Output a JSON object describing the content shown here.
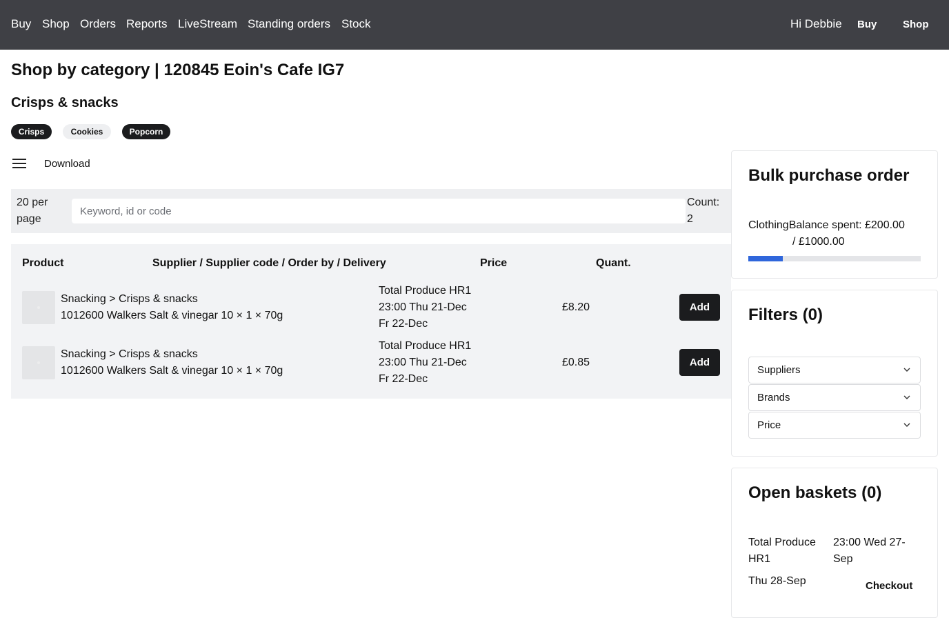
{
  "nav": {
    "links": [
      "Buy",
      "Shop",
      "Orders",
      "Reports",
      "LiveStream",
      "Standing orders",
      "Stock"
    ],
    "greeting": "Hi Debbie",
    "right_buttons": [
      "Buy",
      "Shop"
    ]
  },
  "page": {
    "title": "Shop by category | 120845 Eoin's Cafe IG7",
    "section": "Crisps & snacks",
    "subcategories": [
      "Crisps",
      "Cookies",
      "Popcorn"
    ],
    "download_label": "Download"
  },
  "toolbar": {
    "per_page": "20 per page",
    "search_placeholder": "Keyword, id or code",
    "count_label": "Count:",
    "count_value": "2"
  },
  "table": {
    "headers": [
      "Product",
      "Supplier / Supplier code / Order by / Delivery",
      "Price",
      "Quant."
    ],
    "rows": [
      {
        "category": "Snacking > Crisps & snacks",
        "product": "1012600 Walkers Salt & vinegar 10 × 1 × 70g",
        "supplier": "Total Produce HR1",
        "order_by": "23:00 Thu 21-Dec",
        "delivery": "Fr 22-Dec",
        "price": "£8.20",
        "action": "Add"
      },
      {
        "category": "Snacking > Crisps & snacks",
        "product": "1012600 Walkers Salt & vinegar 10 × 1 × 70g",
        "supplier": "Total Produce HR1",
        "order_by": "23:00 Thu 21-Dec",
        "delivery": "Fr 22-Dec",
        "price": "£0.85",
        "action": "Add"
      }
    ]
  },
  "bulk": {
    "title": "Bulk purchase order",
    "category": "Clothing",
    "balance_label": "Balance spent: £200.00",
    "balance_total": "/ £1000.00",
    "progress_fraction": 0.2,
    "progress_color": "#2f66db"
  },
  "filters": {
    "title": "Filters (0)",
    "dropdowns": [
      "Suppliers",
      "Brands",
      "Price"
    ]
  },
  "baskets": {
    "title": "Open baskets (0)",
    "supplier": "Total Produce HR1",
    "cutoff": "23:00 Wed 27-Sep",
    "delivery": "Thu 28-Sep",
    "checkout_label": "Checkout"
  }
}
